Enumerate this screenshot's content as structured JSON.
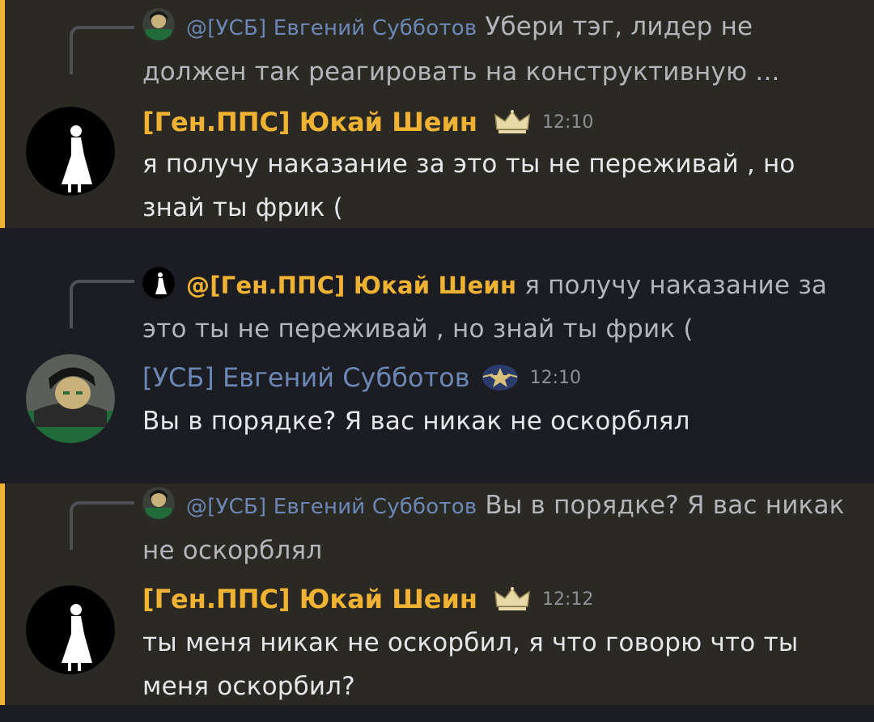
{
  "messages": [
    {
      "reply": {
        "author": "@[УСБ] Евгений Субботов",
        "text": "Убери тэг, лидер не должен так реагировать на конструктивную ..."
      },
      "author": "[Ген.ППС] Юкай Шеин",
      "badge_icon": "crown-icon",
      "time": "12:10",
      "text": "я получу наказание за это ты не переживай , но знай ты фрик ("
    },
    {
      "reply": {
        "author": "@[Ген.ППС] Юкай Шеин",
        "text": "я получу наказание за это ты не переживай , но знай ты фрик ("
      },
      "author": "[УСБ] Евгений Субботов",
      "badge_icon": "police-emblem-icon",
      "time": "12:10",
      "text": "Вы в порядке? Я вас никак не оскорблял"
    },
    {
      "reply": {
        "author": "@[УСБ] Евгений Субботов",
        "text": "Вы в порядке? Я вас никак не оскорблял"
      },
      "author": "[Ген.ППС] Юкай Шеин",
      "badge_icon": "crown-icon",
      "time": "12:12",
      "text": "ты меня  никак не оскорбил, я что говорю что ты меня оскорбил?"
    }
  ],
  "colors": {
    "highlight_bg": "#2b2924",
    "plain_bg": "#1c1d22",
    "mention_bar": "#f0b232",
    "gold_name": "#f0b232",
    "blue_name": "#6b87b5"
  }
}
